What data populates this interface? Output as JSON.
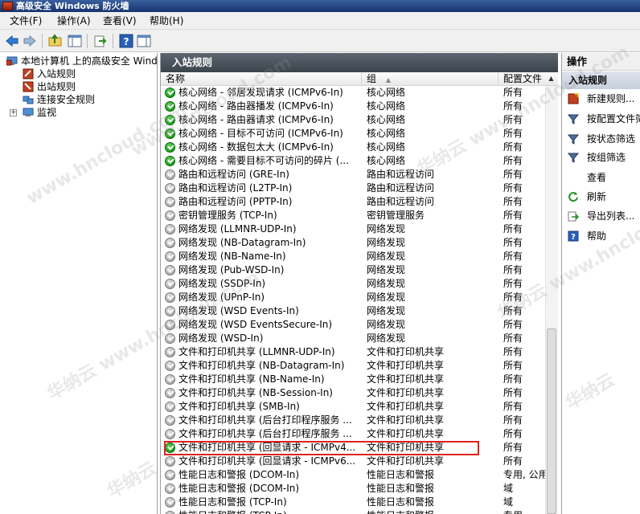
{
  "window": {
    "title": "高级安全 Windows 防火墙"
  },
  "menu": [
    "文件(F)",
    "操作(A)",
    "查看(V)",
    "帮助(H)"
  ],
  "toolbar": {
    "buttons": [
      "back-arrow-icon",
      "forward-arrow-icon",
      "up-folder-icon",
      "show-hide-tree-icon",
      "export-icon",
      "help-icon",
      "show-hide-action-pane-icon"
    ]
  },
  "tree": {
    "root": "本地计算机 上的高级安全 Wind",
    "items": [
      "入站规则",
      "出站规则",
      "连接安全规则",
      "监视"
    ]
  },
  "center": {
    "title": "入站规则",
    "columns": {
      "name": "名称",
      "group": "组",
      "profile": "配置文件"
    },
    "rows": [
      {
        "name": "核心网络 - 邻居发现请求 (ICMPv6-In)",
        "group": "核心网络",
        "profile": "所有",
        "enabled": true
      },
      {
        "name": "核心网络 - 路由器播发 (ICMPv6-In)",
        "group": "核心网络",
        "profile": "所有",
        "enabled": true
      },
      {
        "name": "核心网络 - 路由器请求 (ICMPv6-In)",
        "group": "核心网络",
        "profile": "所有",
        "enabled": true
      },
      {
        "name": "核心网络 - 目标不可访问 (ICMPv6-In)",
        "group": "核心网络",
        "profile": "所有",
        "enabled": true
      },
      {
        "name": "核心网络 - 数据包太大 (ICMPv6-In)",
        "group": "核心网络",
        "profile": "所有",
        "enabled": true
      },
      {
        "name": "核心网络 - 需要目标不可访问的碎片 (...",
        "group": "核心网络",
        "profile": "所有",
        "enabled": true
      },
      {
        "name": "路由和远程访问 (GRE-In)",
        "group": "路由和远程访问",
        "profile": "所有",
        "enabled": false
      },
      {
        "name": "路由和远程访问 (L2TP-In)",
        "group": "路由和远程访问",
        "profile": "所有",
        "enabled": false
      },
      {
        "name": "路由和远程访问 (PPTP-In)",
        "group": "路由和远程访问",
        "profile": "所有",
        "enabled": false
      },
      {
        "name": "密钥管理服务 (TCP-In)",
        "group": "密钥管理服务",
        "profile": "所有",
        "enabled": false
      },
      {
        "name": "网络发现 (LLMNR-UDP-In)",
        "group": "网络发现",
        "profile": "所有",
        "enabled": false
      },
      {
        "name": "网络发现 (NB-Datagram-In)",
        "group": "网络发现",
        "profile": "所有",
        "enabled": false
      },
      {
        "name": "网络发现 (NB-Name-In)",
        "group": "网络发现",
        "profile": "所有",
        "enabled": false
      },
      {
        "name": "网络发现 (Pub-WSD-In)",
        "group": "网络发现",
        "profile": "所有",
        "enabled": false
      },
      {
        "name": "网络发现 (SSDP-In)",
        "group": "网络发现",
        "profile": "所有",
        "enabled": false
      },
      {
        "name": "网络发现 (UPnP-In)",
        "group": "网络发现",
        "profile": "所有",
        "enabled": false
      },
      {
        "name": "网络发现 (WSD Events-In)",
        "group": "网络发现",
        "profile": "所有",
        "enabled": false
      },
      {
        "name": "网络发现 (WSD EventsSecure-In)",
        "group": "网络发现",
        "profile": "所有",
        "enabled": false
      },
      {
        "name": "网络发现 (WSD-In)",
        "group": "网络发现",
        "profile": "所有",
        "enabled": false
      },
      {
        "name": "文件和打印机共享 (LLMNR-UDP-In)",
        "group": "文件和打印机共享",
        "profile": "所有",
        "enabled": false
      },
      {
        "name": "文件和打印机共享 (NB-Datagram-In)",
        "group": "文件和打印机共享",
        "profile": "所有",
        "enabled": false
      },
      {
        "name": "文件和打印机共享 (NB-Name-In)",
        "group": "文件和打印机共享",
        "profile": "所有",
        "enabled": false
      },
      {
        "name": "文件和打印机共享 (NB-Session-In)",
        "group": "文件和打印机共享",
        "profile": "所有",
        "enabled": false
      },
      {
        "name": "文件和打印机共享 (SMB-In)",
        "group": "文件和打印机共享",
        "profile": "所有",
        "enabled": false
      },
      {
        "name": "文件和打印机共享 (后台打印程序服务 ...",
        "group": "文件和打印机共享",
        "profile": "所有",
        "enabled": false
      },
      {
        "name": "文件和打印机共享 (后台打印程序服务 ...",
        "group": "文件和打印机共享",
        "profile": "所有",
        "enabled": false
      },
      {
        "name": "文件和打印机共享 (回显请求 - ICMPv4...",
        "group": "文件和打印机共享",
        "profile": "所有",
        "enabled": true,
        "highlight": true
      },
      {
        "name": "文件和打印机共享 (回显请求 - ICMPv6...",
        "group": "文件和打印机共享",
        "profile": "所有",
        "enabled": false
      },
      {
        "name": "性能日志和警报 (DCOM-In)",
        "group": "性能日志和警报",
        "profile": "专用, 公用",
        "enabled": false
      },
      {
        "name": "性能日志和警报 (DCOM-In)",
        "group": "性能日志和警报",
        "profile": "域",
        "enabled": false
      },
      {
        "name": "性能日志和警报 (TCP-In)",
        "group": "性能日志和警报",
        "profile": "域",
        "enabled": false
      },
      {
        "name": "性能日志和警报 (TCP-In)",
        "group": "性能日志和警报",
        "profile": "专用",
        "enabled": false
      }
    ]
  },
  "actions": {
    "title": "操作",
    "section": "入站规则",
    "items": [
      {
        "label": "新建规则...",
        "icon": "new-rule-icon"
      },
      {
        "label": "按配置文件筛",
        "icon": "filter-icon"
      },
      {
        "label": "按状态筛选",
        "icon": "filter-icon"
      },
      {
        "label": "按组筛选",
        "icon": "filter-icon"
      },
      {
        "label": "查看",
        "icon": ""
      },
      {
        "label": "刷新",
        "icon": "refresh-icon"
      },
      {
        "label": "导出列表...",
        "icon": "export-list-icon"
      },
      {
        "label": "帮助",
        "icon": "help-icon"
      }
    ]
  },
  "watermark": {
    "cn": "华纳云",
    "url": "www.hncloud.com"
  }
}
